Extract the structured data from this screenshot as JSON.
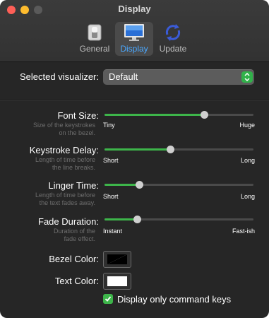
{
  "window": {
    "title": "Display"
  },
  "toolbar": {
    "tabs": [
      {
        "label": "General",
        "icon": "toggle-switch-icon",
        "selected": false
      },
      {
        "label": "Display",
        "icon": "monitor-icon",
        "selected": true
      },
      {
        "label": "Update",
        "icon": "refresh-icon",
        "selected": false
      }
    ]
  },
  "visualizer": {
    "label": "Selected visualizer:",
    "value": "Default"
  },
  "settings": {
    "font_size": {
      "label": "Font Size:",
      "description": "Size of the keystrokes on the bezel.",
      "min_label": "Tiny",
      "max_label": "Huge",
      "value_fraction": 0.67
    },
    "keystroke_delay": {
      "label": "Keystroke Delay:",
      "description": "Length of time before the line breaks.",
      "min_label": "Short",
      "max_label": "Long",
      "value_fraction": 0.44
    },
    "linger_time": {
      "label": "Linger Time:",
      "description": "Length of time before the text fades away.",
      "min_label": "Short",
      "max_label": "Long",
      "value_fraction": 0.23
    },
    "fade_duration": {
      "label": "Fade Duration:",
      "description": "Duration of the fade effect.",
      "min_label": "Instant",
      "max_label": "Fast-ish",
      "value_fraction": 0.22
    }
  },
  "colors": {
    "bezel": {
      "label": "Bezel Color:"
    },
    "text": {
      "label": "Text Color:"
    }
  },
  "display_only_command_keys": {
    "label": "Display only command keys",
    "checked": true
  },
  "accent_colors": {
    "green": "#3db54a",
    "blue": "#4aa8ff"
  }
}
